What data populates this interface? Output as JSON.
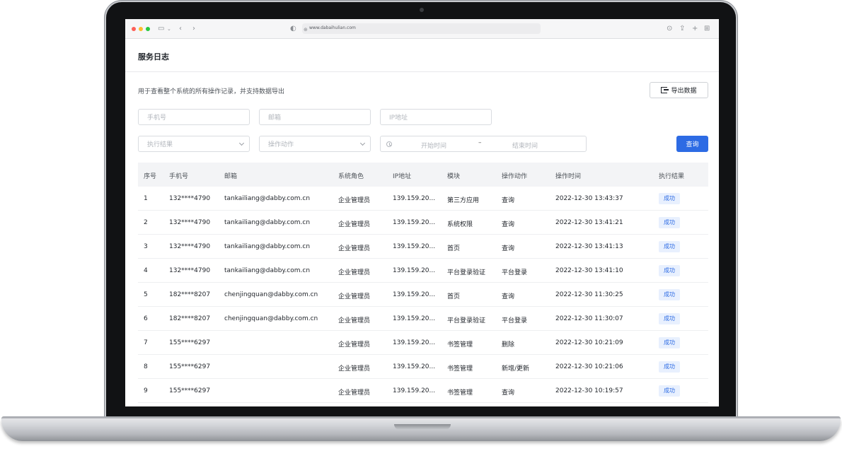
{
  "browser": {
    "url": "www.dabaihulian.com"
  },
  "page": {
    "title": "服务日志",
    "description": "用于查看整个系统的所有操作记录，并支持数据导出",
    "export_label": "导出数据"
  },
  "filters": {
    "phone_placeholder": "手机号",
    "email_placeholder": "邮箱",
    "ip_placeholder": "IP地址",
    "result_placeholder": "执行结果",
    "action_placeholder": "操作动作",
    "start_placeholder": "开始时间",
    "range_separator": "–",
    "end_placeholder": "结束时间",
    "query_label": "查询"
  },
  "table": {
    "headers": [
      "序号",
      "手机号",
      "邮箱",
      "系统角色",
      "IP地址",
      "模块",
      "操作动作",
      "操作时间",
      "执行结果"
    ],
    "rows": [
      [
        "1",
        "132****4790",
        "tankailiang@dabby.com.cn",
        "企业管理员",
        "139.159.20...",
        "第三方应用",
        "查询",
        "2022-12-30 13:43:37",
        "成功"
      ],
      [
        "2",
        "132****4790",
        "tankailiang@dabby.com.cn",
        "企业管理员",
        "139.159.20...",
        "系统权限",
        "查询",
        "2022-12-30 13:41:21",
        "成功"
      ],
      [
        "3",
        "132****4790",
        "tankailiang@dabby.com.cn",
        "企业管理员",
        "139.159.20...",
        "首页",
        "查询",
        "2022-12-30 13:41:13",
        "成功"
      ],
      [
        "4",
        "132****4790",
        "tankailiang@dabby.com.cn",
        "企业管理员",
        "139.159.20...",
        "平台登录验证",
        "平台登录",
        "2022-12-30 13:41:10",
        "成功"
      ],
      [
        "5",
        "182****8207",
        "chenjingquan@dabby.com.cn",
        "企业管理员",
        "139.159.20...",
        "首页",
        "查询",
        "2022-12-30 11:30:25",
        "成功"
      ],
      [
        "6",
        "182****8207",
        "chenjingquan@dabby.com.cn",
        "企业管理员",
        "139.159.20...",
        "平台登录验证",
        "平台登录",
        "2022-12-30 11:30:07",
        "成功"
      ],
      [
        "7",
        "155****6297",
        "",
        "企业管理员",
        "139.159.20...",
        "书签管理",
        "删除",
        "2022-12-30 10:21:09",
        "成功"
      ],
      [
        "8",
        "155****6297",
        "",
        "企业管理员",
        "139.159.20...",
        "书签管理",
        "新增/更新",
        "2022-12-30 10:21:06",
        "成功"
      ],
      [
        "9",
        "155****6297",
        "",
        "企业管理员",
        "139.159.20...",
        "书签管理",
        "查询",
        "2022-12-30 10:19:57",
        "成功"
      ]
    ]
  },
  "colors": {
    "accent": "#2d6be4",
    "success_bg": "#e8f0fe",
    "header_bg": "#f3f4f6"
  }
}
